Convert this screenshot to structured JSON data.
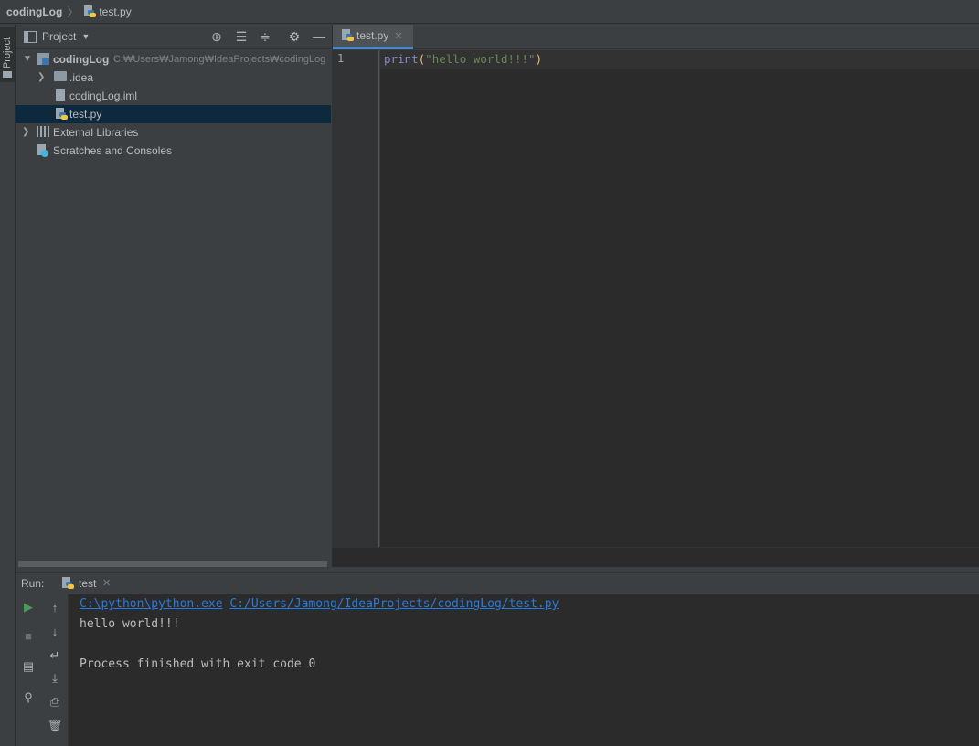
{
  "navbar": {
    "project": "codingLog",
    "file": "test.py"
  },
  "left_stripe": {
    "project_label": "Project"
  },
  "project_panel": {
    "title": "Project",
    "tree": {
      "root_name": "codingLog",
      "root_path": "C:₩Users₩Jamong₩IdeaProjects₩codingLog",
      "items": [
        {
          "label": ".idea"
        },
        {
          "label": "codingLog.iml"
        },
        {
          "label": "test.py"
        },
        {
          "label": "External Libraries"
        },
        {
          "label": "Scratches and Consoles"
        }
      ]
    }
  },
  "editor": {
    "tab_label": "test.py",
    "line_number": "1",
    "code": {
      "func": "print",
      "open_paren": "(",
      "string": "\"hello world!!!\"",
      "close_paren": ")"
    }
  },
  "run_panel": {
    "run_label": "Run:",
    "tab_label": "test",
    "console": {
      "interpreter": "C:\\python\\python.exe",
      "script": "C:/Users/Jamong/IdeaProjects/codingLog/test.py",
      "output": "hello world!!!",
      "exit_message": "Process finished with exit code 0"
    }
  },
  "icons": {
    "navbar_file": "python-file-icon",
    "tree_root": "project-folder-icon",
    "tree_idea": "folder-icon",
    "tree_iml": "module-file-icon",
    "tree_test": "python-file-icon",
    "tree_libs": "library-icon",
    "tree_scratches": "scratches-icon",
    "header_buttons": [
      "locate-icon",
      "expand-all-icon",
      "collapse-all-icon",
      "gear-icon",
      "minimize-icon"
    ],
    "run_tools": [
      "run-icon",
      "stop-icon",
      "layout-icon",
      "pin-icon"
    ],
    "console_tools": [
      "up-arrow-icon",
      "down-arrow-icon",
      "soft-wrap-icon",
      "scroll-to-end-icon",
      "print-icon",
      "trash-icon"
    ]
  },
  "colors": {
    "background": "#3c3f41",
    "editor_bg": "#2b2b2b",
    "selection": "#0d293e",
    "tab_accent": "#4a88c7",
    "keyword": "#8888c6",
    "string": "#6a8759",
    "link": "#287bde",
    "run_green": "#499c54"
  }
}
